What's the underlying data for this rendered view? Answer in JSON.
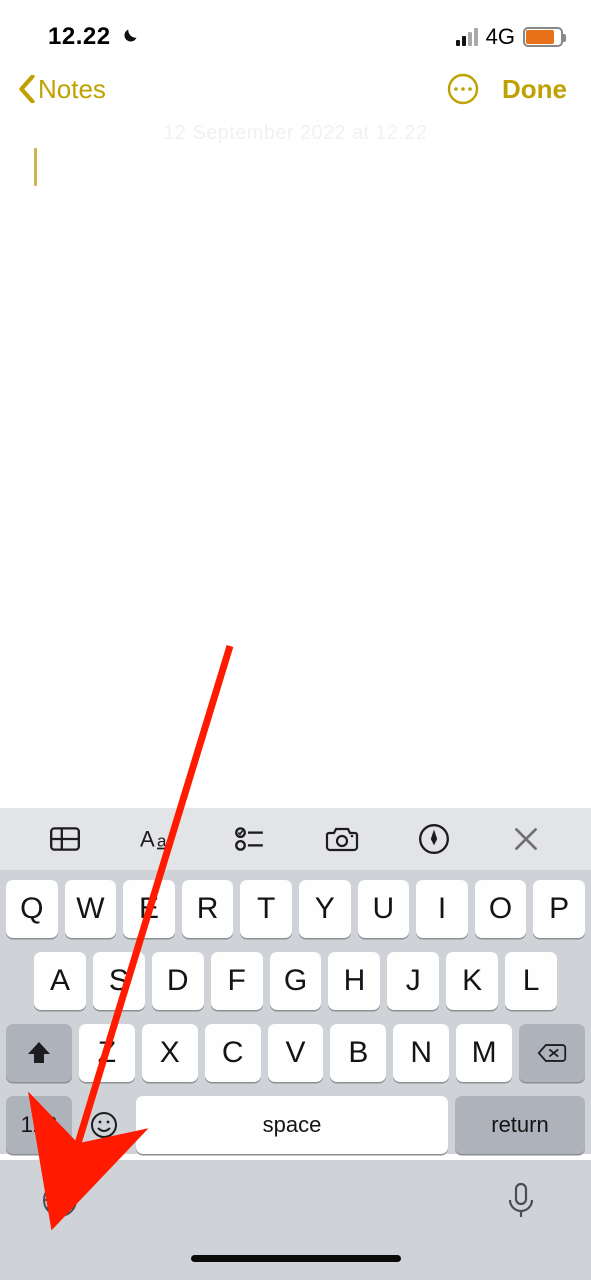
{
  "status": {
    "time": "12.22",
    "network": "4G"
  },
  "nav": {
    "back_label": "Notes",
    "done_label": "Done"
  },
  "note": {
    "timestamp": "12 September 2022 at 12.22"
  },
  "toolbar": {
    "icons": [
      "table-icon",
      "format-icon",
      "checklist-icon",
      "camera-icon",
      "markup-icon",
      "close-icon"
    ]
  },
  "keyboard": {
    "row1": [
      "Q",
      "W",
      "E",
      "R",
      "T",
      "Y",
      "U",
      "I",
      "O",
      "P"
    ],
    "row2": [
      "A",
      "S",
      "D",
      "F",
      "G",
      "H",
      "J",
      "K",
      "L"
    ],
    "row3": [
      "Z",
      "X",
      "C",
      "V",
      "B",
      "N",
      "M"
    ],
    "mode_key": "123",
    "space_label": "space",
    "return_label": "return"
  }
}
